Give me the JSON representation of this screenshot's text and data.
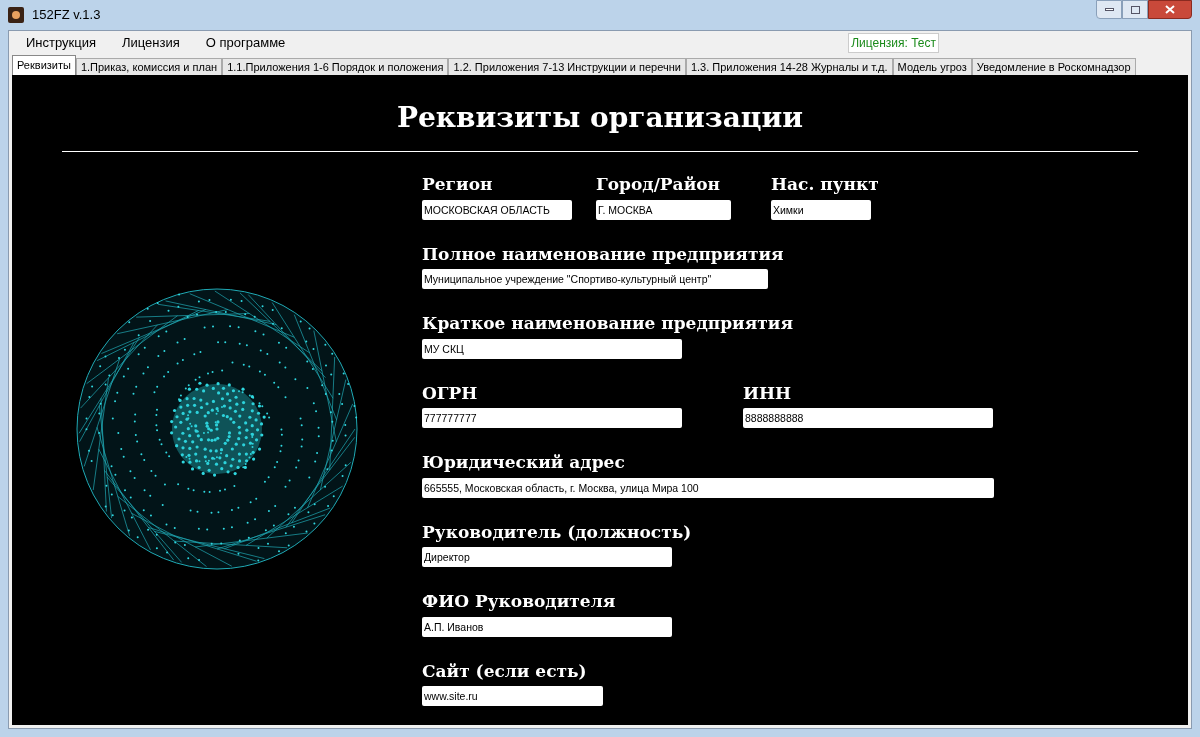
{
  "window": {
    "title": "152FZ v.1.3"
  },
  "menu": [
    "Инструкция",
    "Лицензия",
    "О программе"
  ],
  "license_status": "Лицензия: Тест",
  "tabs": [
    {
      "label": "Реквизиты",
      "selected": true
    },
    {
      "label": "1.Приказ, комиссия и план",
      "selected": false
    },
    {
      "label": "1.1.Приложения 1-6 Порядок и положения",
      "selected": false
    },
    {
      "label": "1.2. Приложения 7-13 Инструкции и перечни",
      "selected": false
    },
    {
      "label": "1.3. Приложения 14-28 Журналы и т.д.",
      "selected": false
    },
    {
      "label": "Модель угроз",
      "selected": false
    },
    {
      "label": "Уведомление в Роскомнадзор",
      "selected": false
    }
  ],
  "heading": "Реквизиты организации",
  "rows": [
    [
      {
        "label": "Регион",
        "value": "МОСКОВСКАЯ ОБЛАСТЬ"
      },
      {
        "label": "Город/Район",
        "value": "Г. МОСКВА"
      },
      {
        "label": "Нас. пункт",
        "value": "Химки"
      }
    ],
    [
      {
        "label": "Полное наименование предприятия",
        "value": "Муниципальное учреждение \"Спортиво-культурный центр\""
      }
    ],
    [
      {
        "label": "Краткое наименование предприятия",
        "value": "МУ СКЦ"
      }
    ],
    [
      {
        "label": "ОГРН",
        "value": "777777777"
      },
      {
        "label": "ИНН",
        "value": "8888888888"
      }
    ],
    [
      {
        "label": "Юридический адрес",
        "value": "665555, Московская область, г. Москва, улица Мира 100"
      }
    ],
    [
      {
        "label": "Руководитель (должность)",
        "value": "Директор"
      }
    ],
    [
      {
        "label": "ФИО Руководителя",
        "value": "А.П. Иванов"
      }
    ],
    [
      {
        "label": "Сайт (если есть)",
        "value": "www.site.ru"
      }
    ]
  ]
}
